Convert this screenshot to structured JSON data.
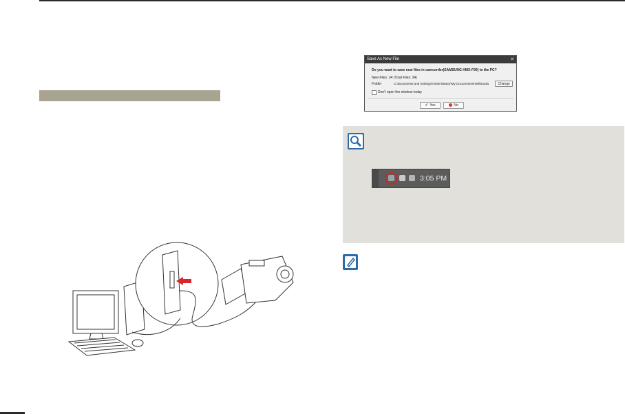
{
  "dialog": {
    "title": "Save As New File",
    "close_glyph": "✕",
    "question": "Do you want to save new files in camcorder(SAMSUNG HMX-F90) to the PC?",
    "new_files": "New Files: 34 (Total Files: 34)",
    "folder_label": "Folder",
    "folder_path": "C:\\Documents and Settings\\Administrator\\My Documents\\IntelliStudio",
    "change_button": "Change",
    "checkbox_label": "Don't open the window today",
    "yes_button": "Yes",
    "no_button": "No"
  },
  "tray": {
    "time": "3:05 PM"
  },
  "icons": {
    "tip": "magnifier-icon",
    "note": "note-pencil-icon"
  },
  "colors": {
    "section_bar": "#a8a491",
    "tip_panel": "#e2e0da",
    "icon_blue": "#2c6ba8",
    "highlight_red": "#d12626"
  }
}
